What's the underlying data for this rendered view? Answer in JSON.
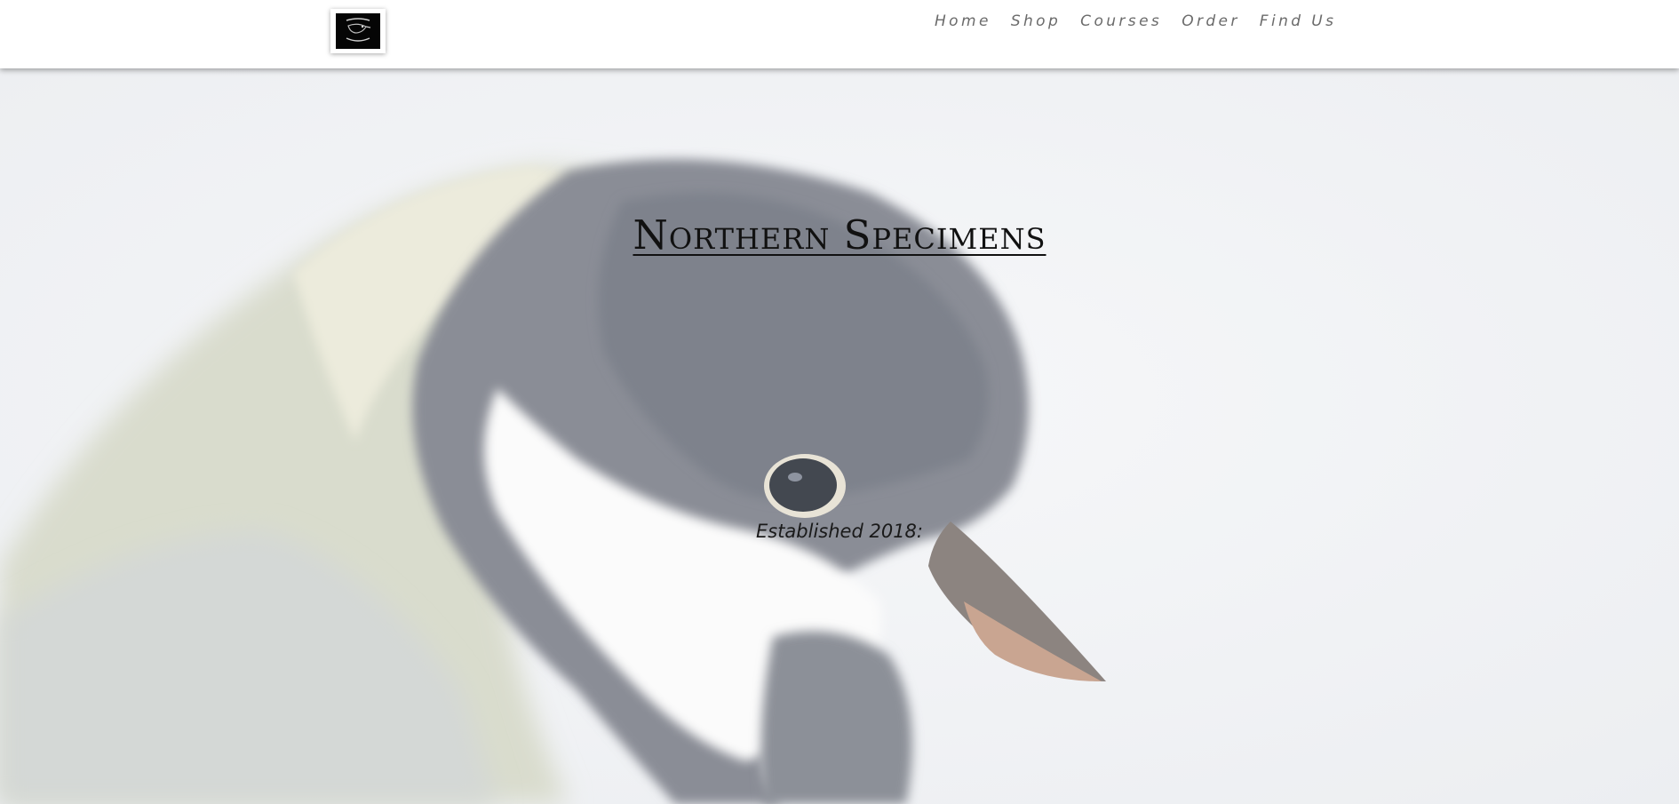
{
  "header": {
    "logo_icon": "bird-emblem-icon",
    "nav": [
      {
        "label": "Home"
      },
      {
        "label": "Shop"
      },
      {
        "label": "Courses"
      },
      {
        "label": "Order"
      },
      {
        "label": "Find Us"
      }
    ]
  },
  "hero": {
    "title": "Northern Specimens",
    "subtitle": "Established 2018:",
    "background_image": "great-tit-bird-photo"
  },
  "colors": {
    "header_bg": "#ffffff",
    "nav_text": "#6b6b6b",
    "hero_bg": "#f4f5f7",
    "title_text": "#111111"
  }
}
